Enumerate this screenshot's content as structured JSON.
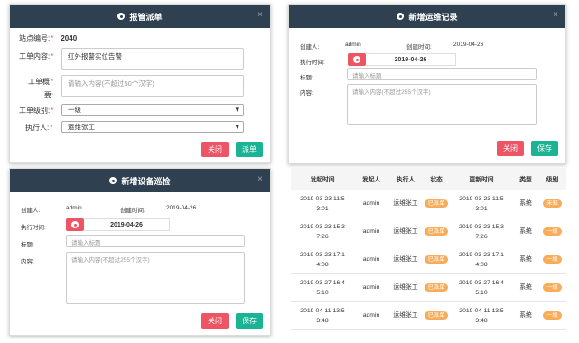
{
  "dispatch": {
    "title": "报管派单",
    "close_x": "×",
    "station_label": "站点编号:",
    "station_value": "2040",
    "content_label": "工单内容:",
    "content_value": "红外报警实位告警",
    "summary_label_1": "工单概",
    "summary_label_2": "要:",
    "summary_placeholder": "请输入内容(不超过50个汉字)",
    "level_label": "工单级别:",
    "level_value": "一级",
    "exec_label": "执行人:",
    "exec_value": "运维张工",
    "required_mark": "*",
    "btn_close": "关闭",
    "btn_dispatch": "派单"
  },
  "maint": {
    "title": "新增运维记录",
    "close_x": "×",
    "creator_label": "创建人:",
    "creator_value": "admin",
    "created_label": "创建时间:",
    "created_value": "2019-04-26",
    "exec_time_label": "执行时间:",
    "exec_time_value": "2019-04-26",
    "title_label": "标题:",
    "title_placeholder": "请输入标题",
    "content_label": "内容:",
    "content_placeholder": "请输入内容(不超过255个汉字)",
    "btn_close": "关闭",
    "btn_save": "保存"
  },
  "patrol": {
    "title": "新增设备巡检",
    "close_x": "×",
    "creator_label": "创建人:",
    "creator_value": "admin",
    "created_label": "创建时间:",
    "created_value": "2019-04-26",
    "exec_time_label": "执行时间:",
    "exec_time_value": "2019-04-26",
    "title_label": "标题:",
    "title_placeholder": "请输入标题",
    "content_label": "内容:",
    "content_placeholder": "请输入内容(不超过255个汉字)",
    "btn_close": "关闭",
    "btn_save": "保存"
  },
  "table": {
    "headers": [
      "发起时间",
      "发起人",
      "执行人",
      "状态",
      "更新时间",
      "类型",
      "级别"
    ],
    "rows": [
      {
        "start1": "2019-03-23 11:5",
        "start2": "3:01",
        "by": "admin",
        "exec": "运维张工",
        "status": "已派单",
        "upd1": "2019-03-23 11:5",
        "upd2": "3:01",
        "type": "系统",
        "level": "未知"
      },
      {
        "start1": "2019-03-23 15:3",
        "start2": "7:26",
        "by": "admin",
        "exec": "运维张工",
        "status": "已派单",
        "upd1": "2019-03-23 15:3",
        "upd2": "7:26",
        "type": "系统",
        "level": "一级"
      },
      {
        "start1": "2019-03-23 17:1",
        "start2": "4:08",
        "by": "admin",
        "exec": "运维张工",
        "status": "已派单",
        "upd1": "2019-03-23 17:1",
        "upd2": "4:08",
        "type": "系统",
        "level": "一级"
      },
      {
        "start1": "2019-03-27 16:4",
        "start2": "5:10",
        "by": "admin",
        "exec": "运维张工",
        "status": "已派单",
        "upd1": "2019-03-27 16:4",
        "upd2": "5:10",
        "type": "系统",
        "level": "一级"
      },
      {
        "start1": "2019-04-11 13:5",
        "start2": "3:48",
        "by": "admin",
        "exec": "运维张工",
        "status": "已派单",
        "upd1": "2019-04-11 13:5",
        "upd2": "3:48",
        "type": "系统",
        "level": "一级"
      }
    ]
  },
  "colors": {
    "header_bg": "#2f4050",
    "danger": "#ed5565",
    "success": "#1ab394",
    "badge": "#f8ac59"
  }
}
